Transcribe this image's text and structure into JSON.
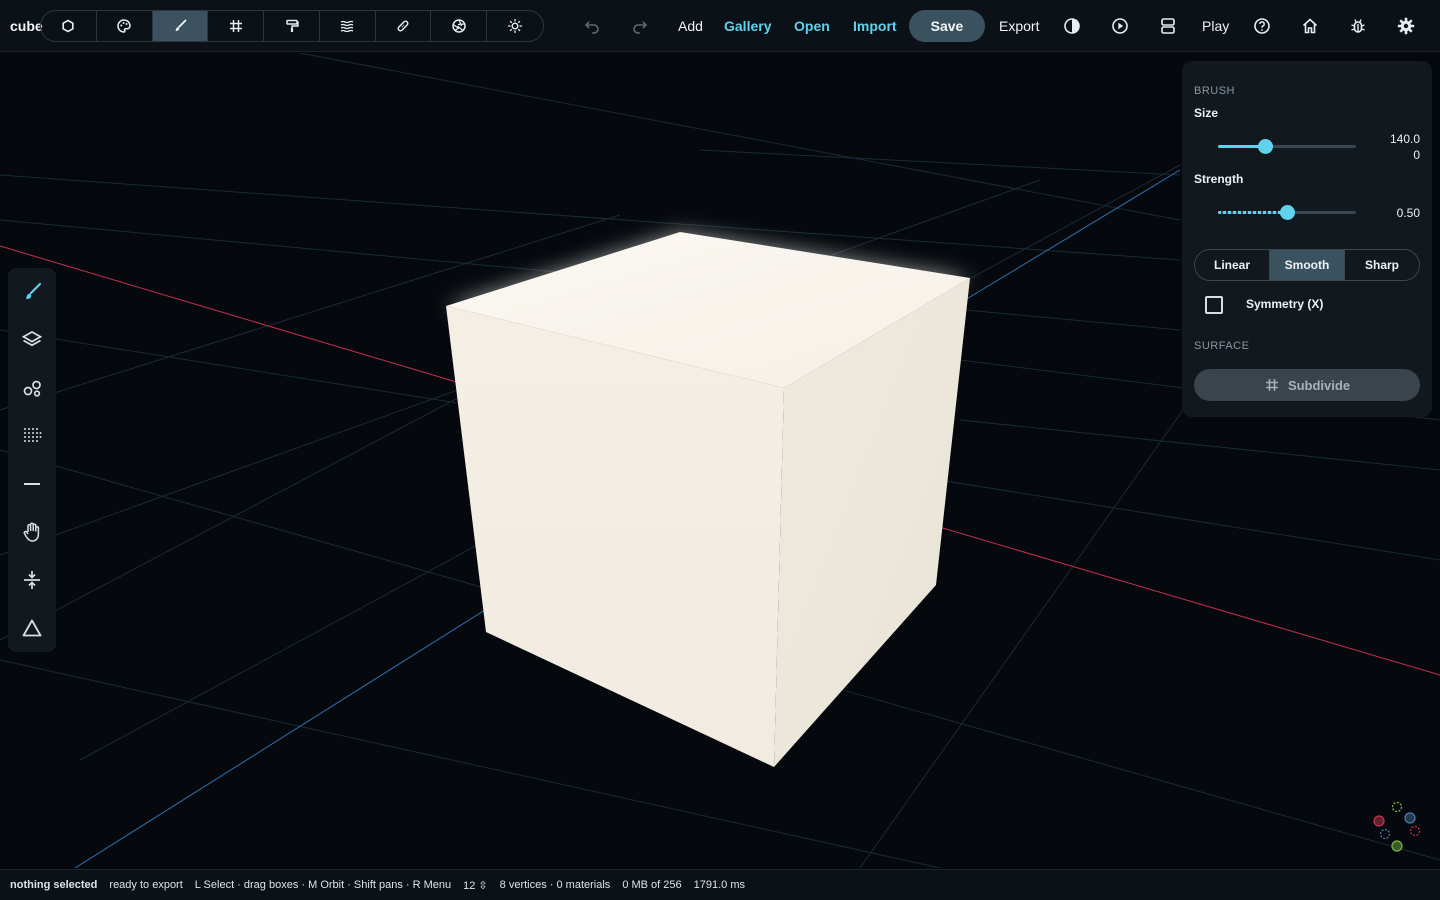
{
  "app": {
    "title": "cube"
  },
  "modes": [
    {
      "name": "select-mode",
      "icon": "circle-icon",
      "active": false
    },
    {
      "name": "paint-mode",
      "icon": "palette-icon",
      "active": false
    },
    {
      "name": "brush-mode",
      "icon": "brush-icon",
      "active": true
    },
    {
      "name": "grid-mode",
      "icon": "grid-icon",
      "active": false
    },
    {
      "name": "roller-mode",
      "icon": "paint-roller-icon",
      "active": false
    },
    {
      "name": "waves-mode",
      "icon": "waves-icon",
      "active": false
    },
    {
      "name": "bandage-mode",
      "icon": "bandage-icon",
      "active": false
    },
    {
      "name": "aperture-mode",
      "icon": "aperture-icon",
      "active": false
    },
    {
      "name": "light-mode",
      "icon": "sun-icon",
      "active": false
    }
  ],
  "toolbar": {
    "add": "Add",
    "gallery": "Gallery",
    "open": "Open",
    "import": "Import",
    "save": "Save",
    "export": "Export",
    "play": "Play"
  },
  "left_tools": [
    "brush-icon",
    "layers-icon",
    "nodes-icon",
    "dot-grid-icon",
    "minus-icon",
    "hand-icon",
    "compress-icon",
    "triangle-icon"
  ],
  "panel": {
    "brush_section": "BRUSH",
    "size_label": "Size",
    "size_value": "140.0\n0",
    "size_fraction": 0.34,
    "strength_label": "Strength",
    "strength_value": "0.50",
    "strength_fraction": 0.5,
    "falloff": [
      "Linear",
      "Smooth",
      "Sharp"
    ],
    "falloff_selected": "Smooth",
    "symmetry_label": "Symmetry (X)",
    "symmetry_checked": false,
    "surface_section": "SURFACE",
    "subdivide_label": "Subdivide"
  },
  "status": {
    "selection": "nothing selected",
    "export_state": "ready to export",
    "hints": "L Select · drag boxes · M Orbit · Shift pans · R Menu",
    "count": "12 ⇳",
    "mesh_info": "8 vertices · 0 materials",
    "memory": "0 MB of 256",
    "time": "1791.0 ms"
  },
  "colors": {
    "accent": "#5fd3ee",
    "background": "#05090d",
    "cube": "#f3ede3",
    "x_axis": "#c8304e",
    "z_axis": "#2f6fb0"
  }
}
